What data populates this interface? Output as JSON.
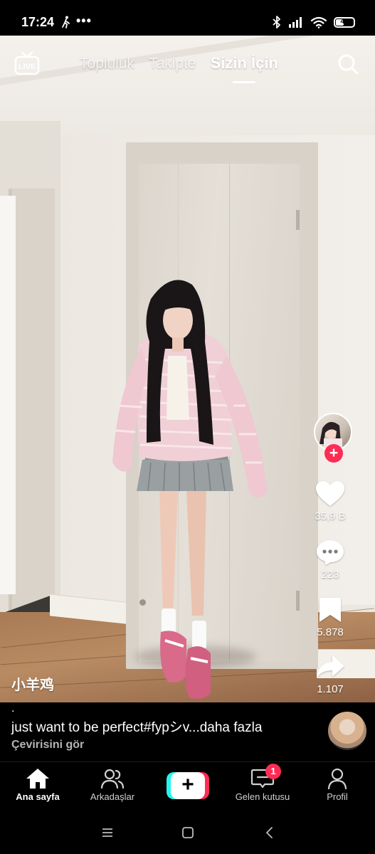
{
  "status_bar": {
    "time": "17:24",
    "dots": "•••",
    "battery_level": "43",
    "icons": [
      "walking-icon",
      "bluetooth-icon",
      "signal-icon",
      "wifi-icon",
      "battery-icon"
    ]
  },
  "top_nav": {
    "live_label": "LIVE",
    "tabs": [
      {
        "label": "Topluluk",
        "active": false
      },
      {
        "label": "Takipte",
        "active": false
      },
      {
        "label": "Sizin İçin",
        "active": true
      }
    ],
    "search_icon": "search-icon"
  },
  "actions": {
    "follow_label": "+",
    "likes": "35,9 B",
    "comments": "223",
    "saves": "5.878",
    "shares": "1.107"
  },
  "video": {
    "author": "小羊鸡",
    "caption_dot": ".",
    "caption": "just want to be perfect#fypシv...",
    "more_label": "daha fazla",
    "translate_label": "Çevirisini gör"
  },
  "bottom_nav": {
    "items": [
      {
        "label": "Ana sayfa",
        "icon": "home-icon",
        "active": true
      },
      {
        "label": "Arkadaşlar",
        "icon": "friends-icon",
        "active": false
      },
      {
        "label": "+",
        "icon": "create-icon",
        "active": false
      },
      {
        "label": "Gelen kutusu",
        "icon": "inbox-icon",
        "active": false,
        "badge": "1"
      },
      {
        "label": "Profil",
        "icon": "profile-icon",
        "active": false
      }
    ]
  },
  "colors": {
    "accent_red": "#fe2c55",
    "accent_cyan": "#25f4ee",
    "background": "#000000"
  }
}
